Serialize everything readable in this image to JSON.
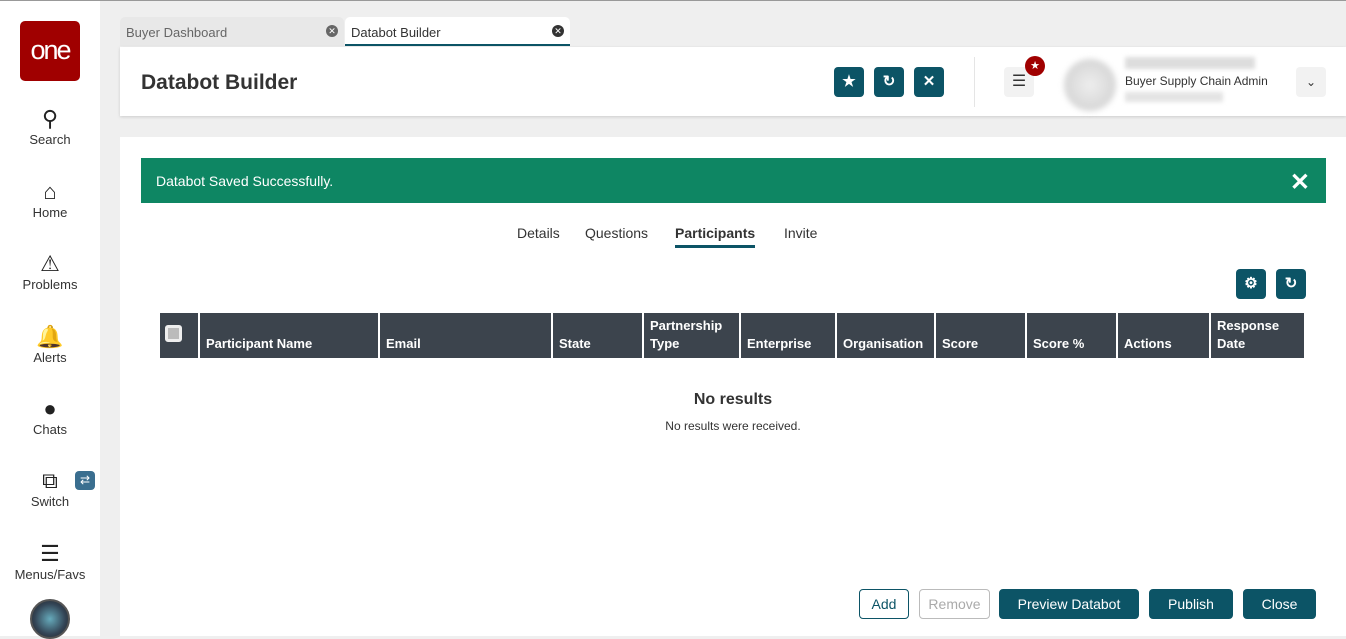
{
  "sidebar": {
    "logo": "one",
    "items": [
      {
        "label": "Search"
      },
      {
        "label": "Home"
      },
      {
        "label": "Problems"
      },
      {
        "label": "Alerts"
      },
      {
        "label": "Chats"
      },
      {
        "label": "Switch"
      },
      {
        "label": "Menus/Favs"
      }
    ]
  },
  "tabs": [
    {
      "label": "Buyer Dashboard"
    },
    {
      "label": "Databot Builder"
    }
  ],
  "header": {
    "title": "Databot Builder",
    "user_role": "Buyer Supply Chain Admin"
  },
  "banner": {
    "message": "Databot Saved Successfully."
  },
  "page_tabs": [
    "Details",
    "Questions",
    "Participants",
    "Invite"
  ],
  "table": {
    "columns": [
      "Participant Name",
      "Email",
      "State",
      "Partnership Type",
      "Enterprise",
      "Organisation",
      "Score",
      "Score %",
      "Actions",
      "Response Date"
    ],
    "empty_title": "No results",
    "empty_message": "No results were received."
  },
  "buttons": {
    "add": "Add",
    "remove": "Remove",
    "preview": "Preview Databot",
    "publish": "Publish",
    "close": "Close"
  }
}
